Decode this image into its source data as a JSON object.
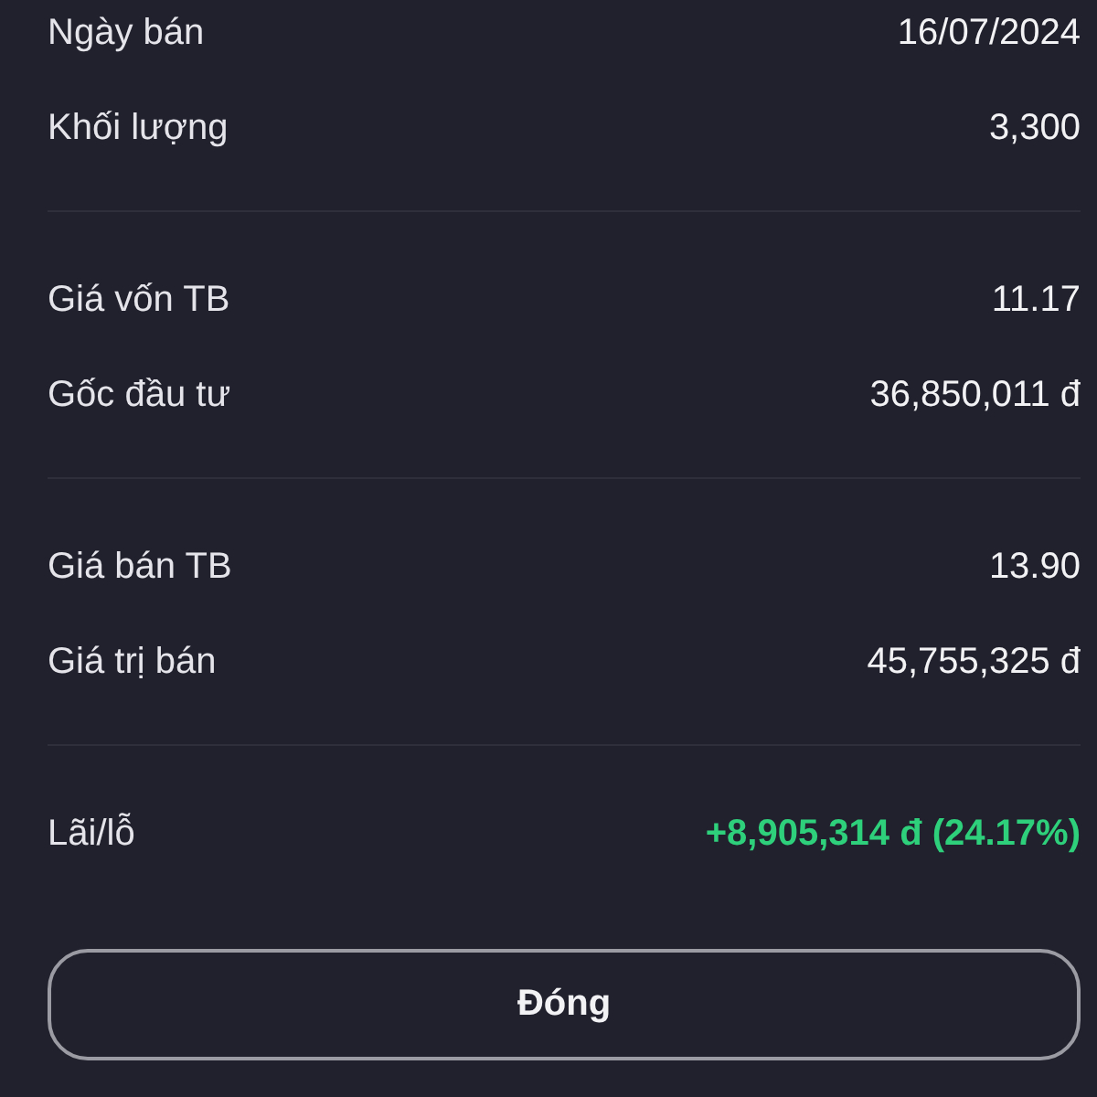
{
  "sections": [
    {
      "rows": [
        {
          "label": "Ngày bán",
          "value": "16/07/2024",
          "kind": "plain"
        },
        {
          "label": "Khối lượng",
          "value": "3,300",
          "kind": "plain"
        }
      ]
    },
    {
      "rows": [
        {
          "label": "Giá vốn TB",
          "value": "11.17",
          "kind": "plain"
        },
        {
          "label": "Gốc đầu tư",
          "value": "36,850,011 đ",
          "kind": "plain"
        }
      ]
    },
    {
      "rows": [
        {
          "label": "Giá bán TB",
          "value": "13.90",
          "kind": "plain"
        },
        {
          "label": "Giá trị bán",
          "value": "45,755,325 đ",
          "kind": "plain"
        }
      ]
    },
    {
      "rows": [
        {
          "label": "Lãi/lỗ",
          "value": "+8,905,314 đ (24.17%)",
          "kind": "gain"
        }
      ]
    }
  ],
  "button": {
    "label": "Đóng"
  }
}
